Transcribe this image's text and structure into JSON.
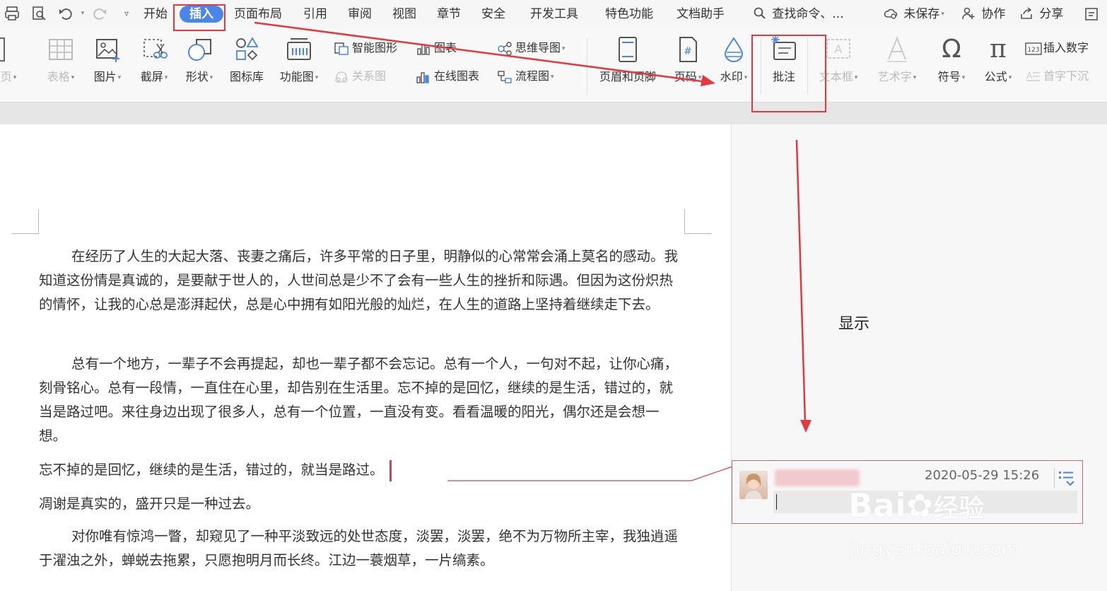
{
  "toolbar_tabs": [
    "开始",
    "插入",
    "页面布局",
    "引用",
    "审阅",
    "视图",
    "章节",
    "安全",
    "开发工具",
    "特色功能",
    "文档助手"
  ],
  "search": {
    "label": "查找命令、..."
  },
  "right_actions": {
    "unsaved": "未保存",
    "collab": "协作",
    "share": "分享"
  },
  "ribbon": {
    "page_partial": "页",
    "table": "表格",
    "picture": "图片",
    "screenshot": "截屏",
    "shape": "形状",
    "icon_lib": "图标库",
    "func_chart": "功能图",
    "smart_shape": "智能图形",
    "chart": "图表",
    "mindmap": "思维导图",
    "relation": "关系图",
    "online_chart": "在线图表",
    "flowchart": "流程图",
    "header_footer": "页眉和页脚",
    "page_num": "页码",
    "watermark": "水印",
    "comment": "批注",
    "textbox": "文本框",
    "wordart": "艺术字",
    "symbol": "符号",
    "formula": "公式",
    "insert_number": "插入数字",
    "drop_cap": "首字下沉"
  },
  "doc": {
    "p1": "在经历了人生的大起大落、丧妻之痛后，许多平常的日子里，明静似的心常常会涌上莫名的感动。我知道这份情是真诚的，是要献于世人的，人世间总是少不了会有一些人生的挫折和际遇。但因为这份炽热的情怀，让我的心总是澎湃起伏，总是心中拥有如阳光般的灿烂，在人生的道路上坚持着继续走下去。",
    "p2": "总有一个地方，一辈子不会再提起，却也一辈子都不会忘记。总有一个人，一句对不起，让你心痛，刻骨铭心。总有一段情，一直住在心里，却告别在生活里。忘不掉的是回忆，继续的是生活，错过的，就当是路过吧。来往身边出现了很多人，总有一个位置，一直没有变。看看温暖的阳光，偶尔还是会想一想。",
    "p3": "忘不掉的是回忆，继续的是生活，错过的，就当是路过。",
    "p4": "凋谢是真实的，盛开只是一种过去。",
    "p5": "对你唯有惊鸿一瞥，却窥见了一种平淡致远的处世态度，淡罢，淡罢，绝不为万物所主宰，我独逍遥于濯浊之外，蝉蜕去拖累，只愿抱明月而长终。江边一蓑烟草，一片缟素。"
  },
  "annotation": {
    "label": "显示"
  },
  "comment": {
    "timestamp": "2020-05-29 15:26"
  },
  "watermark": {
    "brand": "Bai",
    "brand_cn": "经验",
    "url": "jingyan.baidu.com"
  },
  "colors": {
    "accent": "#4a86e8",
    "highlight_red": "#e0393e"
  }
}
